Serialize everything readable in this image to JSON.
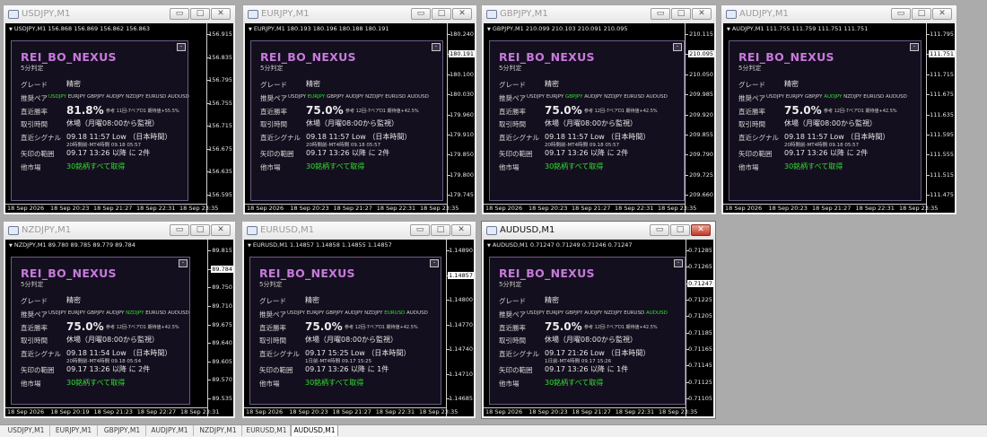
{
  "windows": [
    {
      "title": "USDJPY,M1",
      "symbol_line": "USDJPY,M1  156.868 156.869 156.862 156.863",
      "prices": [
        "156.915",
        "156.835",
        "156.795",
        "156.755",
        "156.715",
        "156.675",
        "156.635",
        "156.595"
      ],
      "current_price": "156.863",
      "times": [
        "18 Sep 2026",
        "18 Sep 20:23",
        "18 Sep 21:27",
        "18 Sep 22:31",
        "18 Sep 23:35"
      ],
      "candle_color": "#1fe01f",
      "panel": {
        "title": "REI_BO_NEXUS",
        "subtitle": "5分判定",
        "grade_label": "グレード",
        "grade_value": "精密",
        "pairs_label": "推奨ペア",
        "pairs": [
          "USDJPY",
          "EURJPY",
          "GBPJPY",
          "AUDJPY",
          "NZDJPY",
          "EURUSD",
          "AUDUSD"
        ],
        "highlight_pair": "USDJPY",
        "winrate_label": "直近勝率",
        "winrate_value": "81.8%",
        "winrate_ref": "参考 11回-7ベアD1 期待値+55.5%",
        "hours_label": "取引時間",
        "hours_value": "休場（月曜08:00から監視）",
        "signal_label": "直近シグナル",
        "signal_value": "09.18 11:57 Low （日本時間）",
        "signal_sub": "20時間前-MT4時間 09.18 05:57",
        "range_label": "矢印の範囲",
        "range_value": "09.17 13:26 以降 に 2件",
        "other_label": "他市場",
        "other_value": "30銘柄すべて取得"
      }
    },
    {
      "title": "EURJPY,M1",
      "symbol_line": "EURJPY,M1  180.193 180.196 180.188 180.191",
      "prices": [
        "180.240",
        "180.191",
        "180.100",
        "180.030",
        "179.960",
        "179.910",
        "179.850",
        "179.800",
        "179.745"
      ],
      "current_price": "180.191",
      "times": [
        "18 Sep 2026",
        "18 Sep 20:23",
        "18 Sep 21:27",
        "18 Sep 22:31",
        "18 Sep 23:35"
      ],
      "candle_color": "#1fe01f",
      "panel": {
        "title": "REI_BO_NEXUS",
        "subtitle": "5分判定",
        "grade_label": "グレード",
        "grade_value": "精密",
        "pairs_label": "推奨ペア",
        "pairs": [
          "USDJPY",
          "EURJPY",
          "GBPJPY",
          "AUDJPY",
          "NZDJPY",
          "EURUSD",
          "AUDUSD"
        ],
        "highlight_pair": "EURJPY",
        "winrate_label": "直近勝率",
        "winrate_value": "75.0%",
        "winrate_ref": "参考 12回-7ベアD1 期待値+42.5%",
        "hours_label": "取引時間",
        "hours_value": "休場（月曜08:00から監視）",
        "signal_label": "直近シグナル",
        "signal_value": "09.18 11:57 Low （日本時間）",
        "signal_sub": "20時間前-MT4時間 09.18 05:57",
        "range_label": "矢印の範囲",
        "range_value": "09.17 13:26 以降 に 2件",
        "other_label": "他市場",
        "other_value": "30銘柄すべて取得"
      }
    },
    {
      "title": "GBPJPY,M1",
      "symbol_line": "GBPJPY,M1  210.099 210.103 210.091 210.095",
      "prices": [
        "210.115",
        "210.095",
        "210.050",
        "209.985",
        "209.920",
        "209.855",
        "209.790",
        "209.725",
        "209.660"
      ],
      "current_price": "210.095",
      "times": [
        "18 Sep 2026",
        "18 Sep 20:23",
        "18 Sep 21:27",
        "18 Sep 22:31",
        "18 Sep 23:35"
      ],
      "candle_color": "#1fe01f",
      "panel": {
        "title": "REI_BO_NEXUS",
        "subtitle": "5分判定",
        "grade_label": "グレード",
        "grade_value": "精密",
        "pairs_label": "推奨ペア",
        "pairs": [
          "USDJPY",
          "EURJPY",
          "GBPJPY",
          "AUDJPY",
          "NZDJPY",
          "EURUSD",
          "AUDUSD"
        ],
        "highlight_pair": "GBPJPY",
        "winrate_label": "直近勝率",
        "winrate_value": "75.0%",
        "winrate_ref": "参考 12回-7ベアD1 期待値+42.5%",
        "hours_label": "取引時間",
        "hours_value": "休場（月曜08:00から監視）",
        "signal_label": "直近シグナル",
        "signal_value": "09.18 11:57 Low （日本時間）",
        "signal_sub": "20時間前-MT4時間 09.18 05:57",
        "range_label": "矢印の範囲",
        "range_value": "09.17 13:26 以降 に 2件",
        "other_label": "他市場",
        "other_value": "30銘柄すべて取得"
      }
    },
    {
      "title": "AUDJPY,M1",
      "symbol_line": "AUDJPY,M1  111.755 111.759 111.751 111.751",
      "prices": [
        "111.795",
        "111.751",
        "111.715",
        "111.675",
        "111.635",
        "111.595",
        "111.555",
        "111.515",
        "111.475"
      ],
      "current_price": "111.751",
      "times": [
        "18 Sep 2026",
        "18 Sep 20:23",
        "18 Sep 21:27",
        "18 Sep 22:31",
        "18 Sep 23:35"
      ],
      "candle_color": "#1fe01f",
      "panel": {
        "title": "REI_BO_NEXUS",
        "subtitle": "5分判定",
        "grade_label": "グレード",
        "grade_value": "精密",
        "pairs_label": "推奨ペア",
        "pairs": [
          "USDJPY",
          "EURJPY",
          "GBPJPY",
          "AUDJPY",
          "NZDJPY",
          "EURUSD",
          "AUDUSD"
        ],
        "highlight_pair": "AUDJPY",
        "winrate_label": "直近勝率",
        "winrate_value": "75.0%",
        "winrate_ref": "参考 12回-7ベアD1 期待値+42.5%",
        "hours_label": "取引時間",
        "hours_value": "休場（月曜08:00から監視）",
        "signal_label": "直近シグナル",
        "signal_value": "09.18 11:57 Low （日本時間）",
        "signal_sub": "20時間前-MT4時間 09.18 05:57",
        "range_label": "矢印の範囲",
        "range_value": "09.17 13:26 以降 に 2件",
        "other_label": "他市場",
        "other_value": "30銘柄すべて取得"
      }
    },
    {
      "title": "NZDJPY,M1",
      "symbol_line": "NZDJPY,M1  89.780 89.785 89.779 89.784",
      "prices": [
        "89.815",
        "89.784",
        "89.750",
        "89.710",
        "89.675",
        "89.640",
        "89.605",
        "89.570",
        "89.535"
      ],
      "current_price": "89.784",
      "times": [
        "18 Sep 2026",
        "18 Sep 20:19",
        "18 Sep 21:23",
        "18 Sep 22:27",
        "18 Sep 23:31"
      ],
      "candle_color": "#1fe01f",
      "panel": {
        "title": "REI_BO_NEXUS",
        "subtitle": "5分判定",
        "grade_label": "グレード",
        "grade_value": "精密",
        "pairs_label": "推奨ペア",
        "pairs": [
          "USDJPY",
          "EURJPY",
          "GBPJPY",
          "AUDJPY",
          "NZDJPY",
          "EURUSD",
          "AUDUSD"
        ],
        "highlight_pair": "NZDJPY",
        "winrate_label": "直近勝率",
        "winrate_value": "75.0%",
        "winrate_ref": "参考 12回-7ベアD1 期待値+42.5%",
        "hours_label": "取引時間",
        "hours_value": "休場（月曜08:00から監視）",
        "signal_label": "直近シグナル",
        "signal_value": "09.18 11:54 Low （日本時間）",
        "signal_sub": "20時間前-MT4時間 09.18 05:54",
        "range_label": "矢印の範囲",
        "range_value": "09.17 13:26 以降 に 2件",
        "other_label": "他市場",
        "other_value": "30銘柄すべて取得"
      }
    },
    {
      "title": "EURUSD,M1",
      "symbol_line": "EURUSD,M1  1.14857 1.14858 1.14855 1.14857",
      "prices": [
        "1.14890",
        "1.14857",
        "1.14800",
        "1.14770",
        "1.14740",
        "1.14710",
        "1.14685"
      ],
      "current_price": "1.14857",
      "times": [
        "18 Sep 2026",
        "18 Sep 20:23",
        "18 Sep 21:27",
        "18 Sep 22:31",
        "18 Sep 23:35"
      ],
      "candle_color": "#1fe01f",
      "panel": {
        "title": "REI_BO_NEXUS",
        "subtitle": "5分判定",
        "grade_label": "グレード",
        "grade_value": "精密",
        "pairs_label": "推奨ペア",
        "pairs": [
          "USDJPY",
          "EURJPY",
          "GBPJPY",
          "AUDJPY",
          "NZDJPY",
          "EURUSD",
          "AUDUSD"
        ],
        "highlight_pair": "EURUSD",
        "winrate_label": "直近勝率",
        "winrate_value": "75.0%",
        "winrate_ref": "参考 12回-7ベアD1 期待値+42.5%",
        "hours_label": "取引時間",
        "hours_value": "休場（月曜08:00から監視）",
        "signal_label": "直近シグナル",
        "signal_value": "09.17 15:25 Low （日本時間）",
        "signal_sub": "1日前-MT4時間 09.17 15:25",
        "range_label": "矢印の範囲",
        "range_value": "09.17 13:26 以降 に 1件",
        "other_label": "他市場",
        "other_value": "30銘柄すべて取得"
      }
    },
    {
      "title": "AUDUSD,M1",
      "symbol_line": "AUDUSD,M1  0.71247 0.71249 0.71246 0.71247",
      "prices": [
        "0.71285",
        "0.71265",
        "0.71247",
        "0.71225",
        "0.71205",
        "0.71185",
        "0.71165",
        "0.71145",
        "0.71125",
        "0.71105"
      ],
      "current_price": "0.71247",
      "times": [
        "18 Sep 2026",
        "18 Sep 20:23",
        "18 Sep 21:27",
        "18 Sep 22:31",
        "18 Sep 23:35"
      ],
      "candle_color": "#1fe01f",
      "panel": {
        "title": "REI_BO_NEXUS",
        "subtitle": "5分判定",
        "grade_label": "グレード",
        "grade_value": "精密",
        "pairs_label": "推奨ペア",
        "pairs": [
          "USDJPY",
          "EURJPY",
          "GBPJPY",
          "AUDJPY",
          "NZDJPY",
          "EURUSD",
          "AUDUSD"
        ],
        "highlight_pair": "AUDUSD",
        "winrate_label": "直近勝率",
        "winrate_value": "75.0%",
        "winrate_ref": "参考 12回-7ベアD1 期待値+42.5%",
        "hours_label": "取引時間",
        "hours_value": "休場（月曜08:00から監視）",
        "signal_label": "直近シグナル",
        "signal_value": "09.17 21:26 Low （日本時間）",
        "signal_sub": "1日前-MT4時間 09.17 15:26",
        "range_label": "矢印の範囲",
        "range_value": "09.17 13:26 以降 に 1件",
        "other_label": "他市場",
        "other_value": "30銘柄すべて取得"
      }
    }
  ],
  "active_window": "AUDUSD,M1",
  "window_buttons": {
    "minimize": "▭",
    "maximize": "□",
    "close": "✕"
  },
  "panel_button": "-",
  "tabs": [
    "USDJPY,M1",
    "EURJPY,M1",
    "GBPJPY,M1",
    "AUDJPY,M1",
    "NZDJPY,M1",
    "EURUSD,M1",
    "AUDUSD,M1"
  ],
  "active_tab": "AUDUSD,M1"
}
